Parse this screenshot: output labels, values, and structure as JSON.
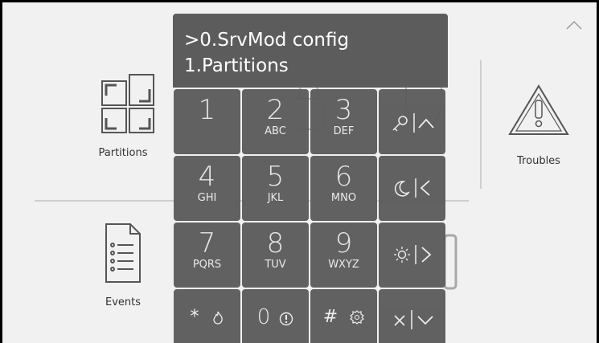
{
  "dashboard": {
    "tiles": [
      {
        "label": "Partitions",
        "icon": "partitions-icon"
      },
      {
        "label": "Troubles",
        "icon": "warning-triangle-icon"
      },
      {
        "label": "Events",
        "icon": "document-icon"
      }
    ],
    "scroll_icon": "chevron-up-icon"
  },
  "keypad": {
    "display": {
      "line1": ">0.SrvMod config",
      "line2": "1.Partitions"
    },
    "keys": [
      {
        "num": "1",
        "sub": ""
      },
      {
        "num": "2",
        "sub": "ABC"
      },
      {
        "num": "3",
        "sub": "DEF"
      },
      {
        "num": "4",
        "sub": "GHI"
      },
      {
        "num": "5",
        "sub": "JKL"
      },
      {
        "num": "6",
        "sub": "MNO"
      },
      {
        "num": "7",
        "sub": "PQRS"
      },
      {
        "num": "8",
        "sub": "TUV"
      },
      {
        "num": "9",
        "sub": "WXYZ"
      },
      {
        "num": "0",
        "sub": ""
      }
    ],
    "function_keys": [
      {
        "symbol": "|^",
        "icon": "key-up-icon"
      },
      {
        "symbol": "|<",
        "icon": "moon-left-icon"
      },
      {
        "symbol": "|>",
        "icon": "sun-right-icon"
      },
      {
        "symbol": "×|v",
        "icon": "cancel-down-icon"
      }
    ],
    "star_key": {
      "symbol": "*",
      "icon": "fire-icon"
    },
    "hash_key": {
      "symbol": "#",
      "icon": "police-badge-icon"
    }
  },
  "colors": {
    "key_bg": "#5c5c5c",
    "screen_bg": "#f1f1f1",
    "text_light": "#ffffff"
  }
}
